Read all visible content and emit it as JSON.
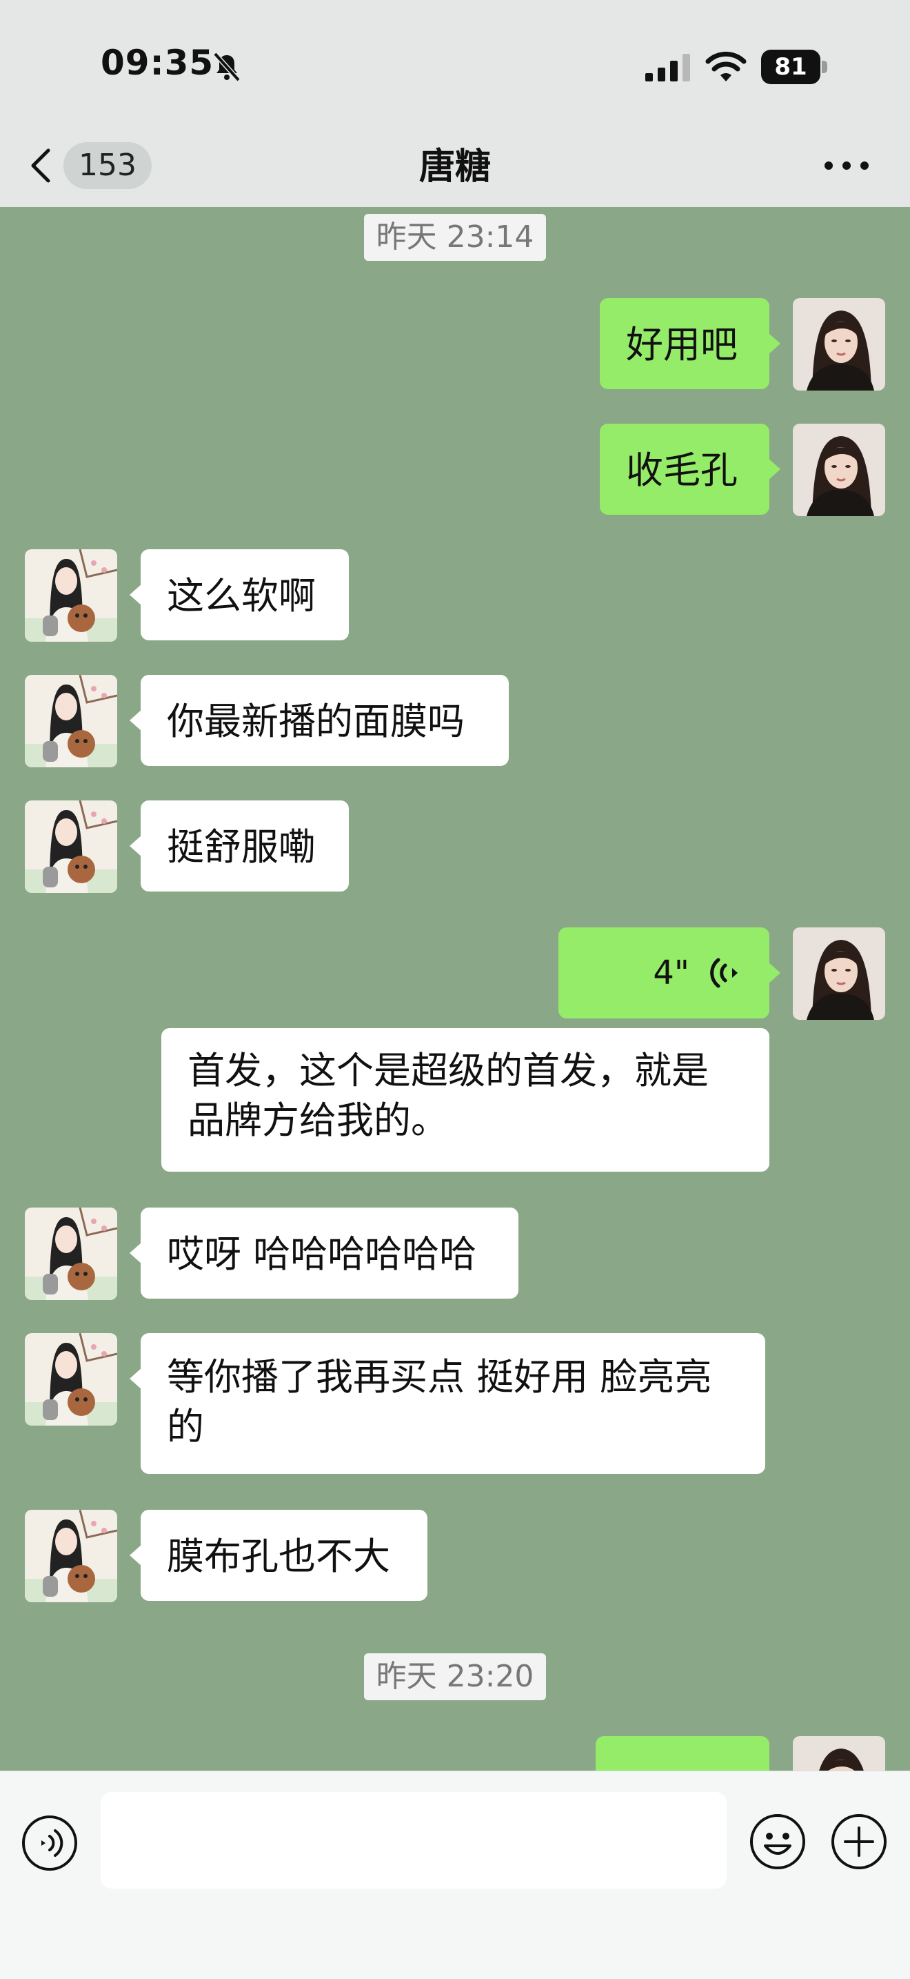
{
  "status_bar": {
    "time": "09:35",
    "battery": "81"
  },
  "header": {
    "back_count": "153",
    "title": "唐糖"
  },
  "messages": {
    "ts1": "昨天 23:14",
    "m1": "好用吧",
    "m2": "收毛孔",
    "m3": "这么软啊",
    "m4": "你最新播的面膜吗",
    "m5": "挺舒服嘞",
    "m6_voice": "4\"",
    "m6_transcript": "首发，这个是超级的首发，就是品牌方给我的。",
    "m7": "哎呀 哈哈哈哈哈哈",
    "m8": "等你播了我再买点 挺好用 脸亮亮的",
    "m9": "膜布孔也不大",
    "ts2": "昨天 23:20"
  },
  "colors": {
    "chat_bg": "#8aa887",
    "my_bubble": "#95ec69",
    "their_bubble": "#ffffff"
  }
}
